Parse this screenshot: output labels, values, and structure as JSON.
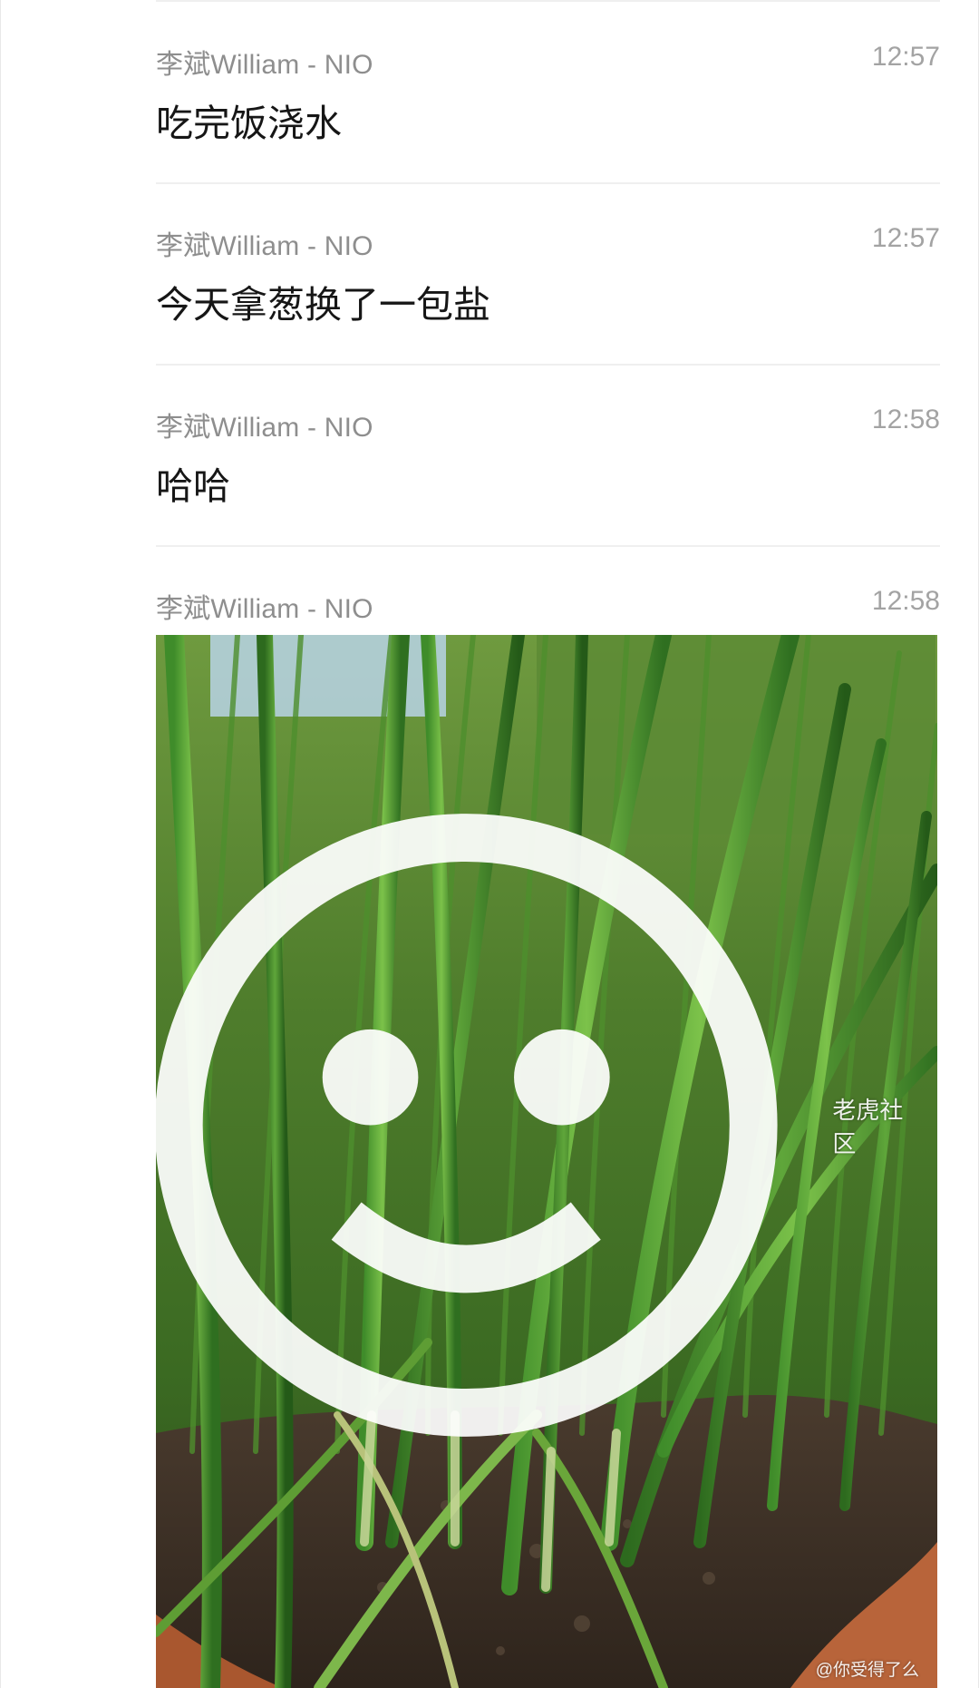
{
  "messages": [
    {
      "sender": "李斌William - NIO",
      "time": "12:57",
      "text": "吃完饭浇水"
    },
    {
      "sender": "李斌William - NIO",
      "time": "12:57",
      "text": "今天拿葱换了一包盐"
    },
    {
      "sender": "李斌William - NIO",
      "time": "12:58",
      "text": "哈哈"
    },
    {
      "sender": "李斌William - NIO",
      "time": "12:58",
      "image": "green-onions-photo"
    }
  ],
  "watermark": {
    "brand": "老虎社区",
    "user": "@你受得了么",
    "icon": "tiger-logo-icon"
  },
  "colors": {
    "sender": "#8e8e8e",
    "time": "#a3a3a3",
    "text": "#161616",
    "divider": "#efefef"
  }
}
